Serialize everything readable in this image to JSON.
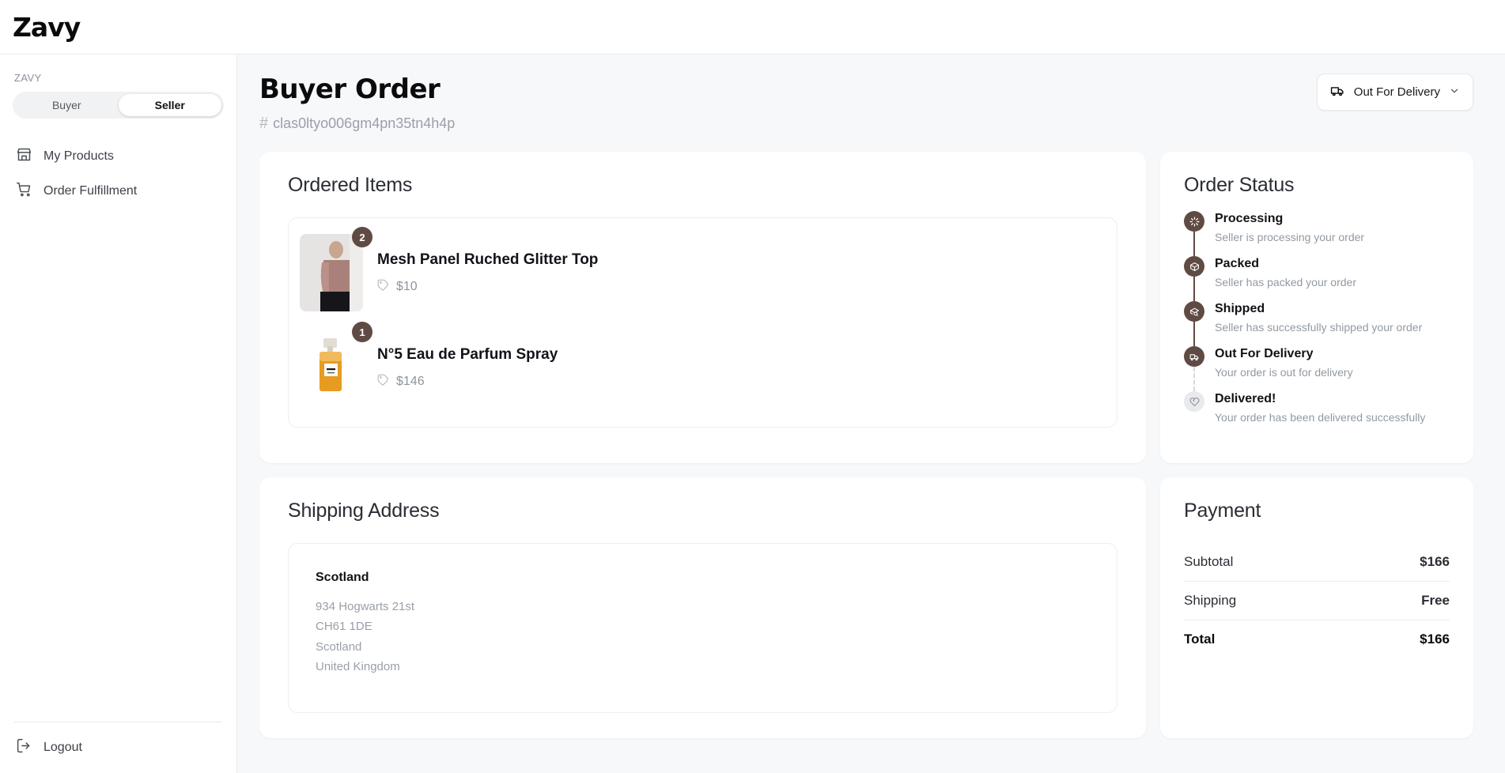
{
  "brand": {
    "name": "Zavy"
  },
  "sidebar": {
    "section_label": "ZAVY",
    "toggle": {
      "buyer": "Buyer",
      "seller": "Seller",
      "active": "Seller"
    },
    "items": [
      {
        "label": "My Products",
        "icon": "store-icon"
      },
      {
        "label": "Order Fulfillment",
        "icon": "shopping-cart-icon"
      }
    ],
    "logout": {
      "label": "Logout",
      "icon": "logout-icon"
    }
  },
  "header": {
    "title": "Buyer Order",
    "order_id": "clas0ltyo006gm4pn35tn4h4p",
    "hash_symbol": "#",
    "status_button": {
      "label": "Out For Delivery",
      "icon": "truck-icon",
      "chevron": "chevron-down-icon"
    }
  },
  "ordered_items": {
    "title": "Ordered Items",
    "items": [
      {
        "name": "Mesh Panel Ruched Glitter Top",
        "price": "$10",
        "qty": "2",
        "image": "model-wearing-mesh-top"
      },
      {
        "name": "N°5 Eau de Parfum Spray",
        "price": "$146",
        "qty": "1",
        "image": "chanel-no5-perfume-bottle"
      }
    ]
  },
  "order_status": {
    "title": "Order Status",
    "steps": [
      {
        "title": "Processing",
        "desc": "Seller is processing your order",
        "icon": "loader-icon",
        "active": true
      },
      {
        "title": "Packed",
        "desc": "Seller has packed your order",
        "icon": "package-icon",
        "active": true
      },
      {
        "title": "Shipped",
        "desc": "Seller has successfully shipped your order",
        "icon": "package-search-icon",
        "active": true
      },
      {
        "title": "Out For Delivery",
        "desc": "Your order is out for delivery",
        "icon": "truck-icon",
        "active": true
      },
      {
        "title": "Delivered!",
        "desc": "Your order has been delivered successfully",
        "icon": "heart-handshake-icon",
        "active": false
      }
    ]
  },
  "shipping_address": {
    "title": "Shipping Address",
    "name": "Scotland",
    "lines": [
      "934 Hogwarts 21st",
      "CH61 1DE",
      "Scotland",
      "United Kingdom"
    ]
  },
  "payment": {
    "title": "Payment",
    "rows": [
      {
        "label": "Subtotal",
        "value": "$166"
      },
      {
        "label": "Shipping",
        "value": "Free"
      },
      {
        "label": "Total",
        "value": "$166"
      }
    ]
  },
  "colors": {
    "accent_brown": "#5f4b43",
    "page_bg": "#f7f8fa",
    "card_bg": "#ffffff",
    "muted_text": "#9aa0a8"
  }
}
